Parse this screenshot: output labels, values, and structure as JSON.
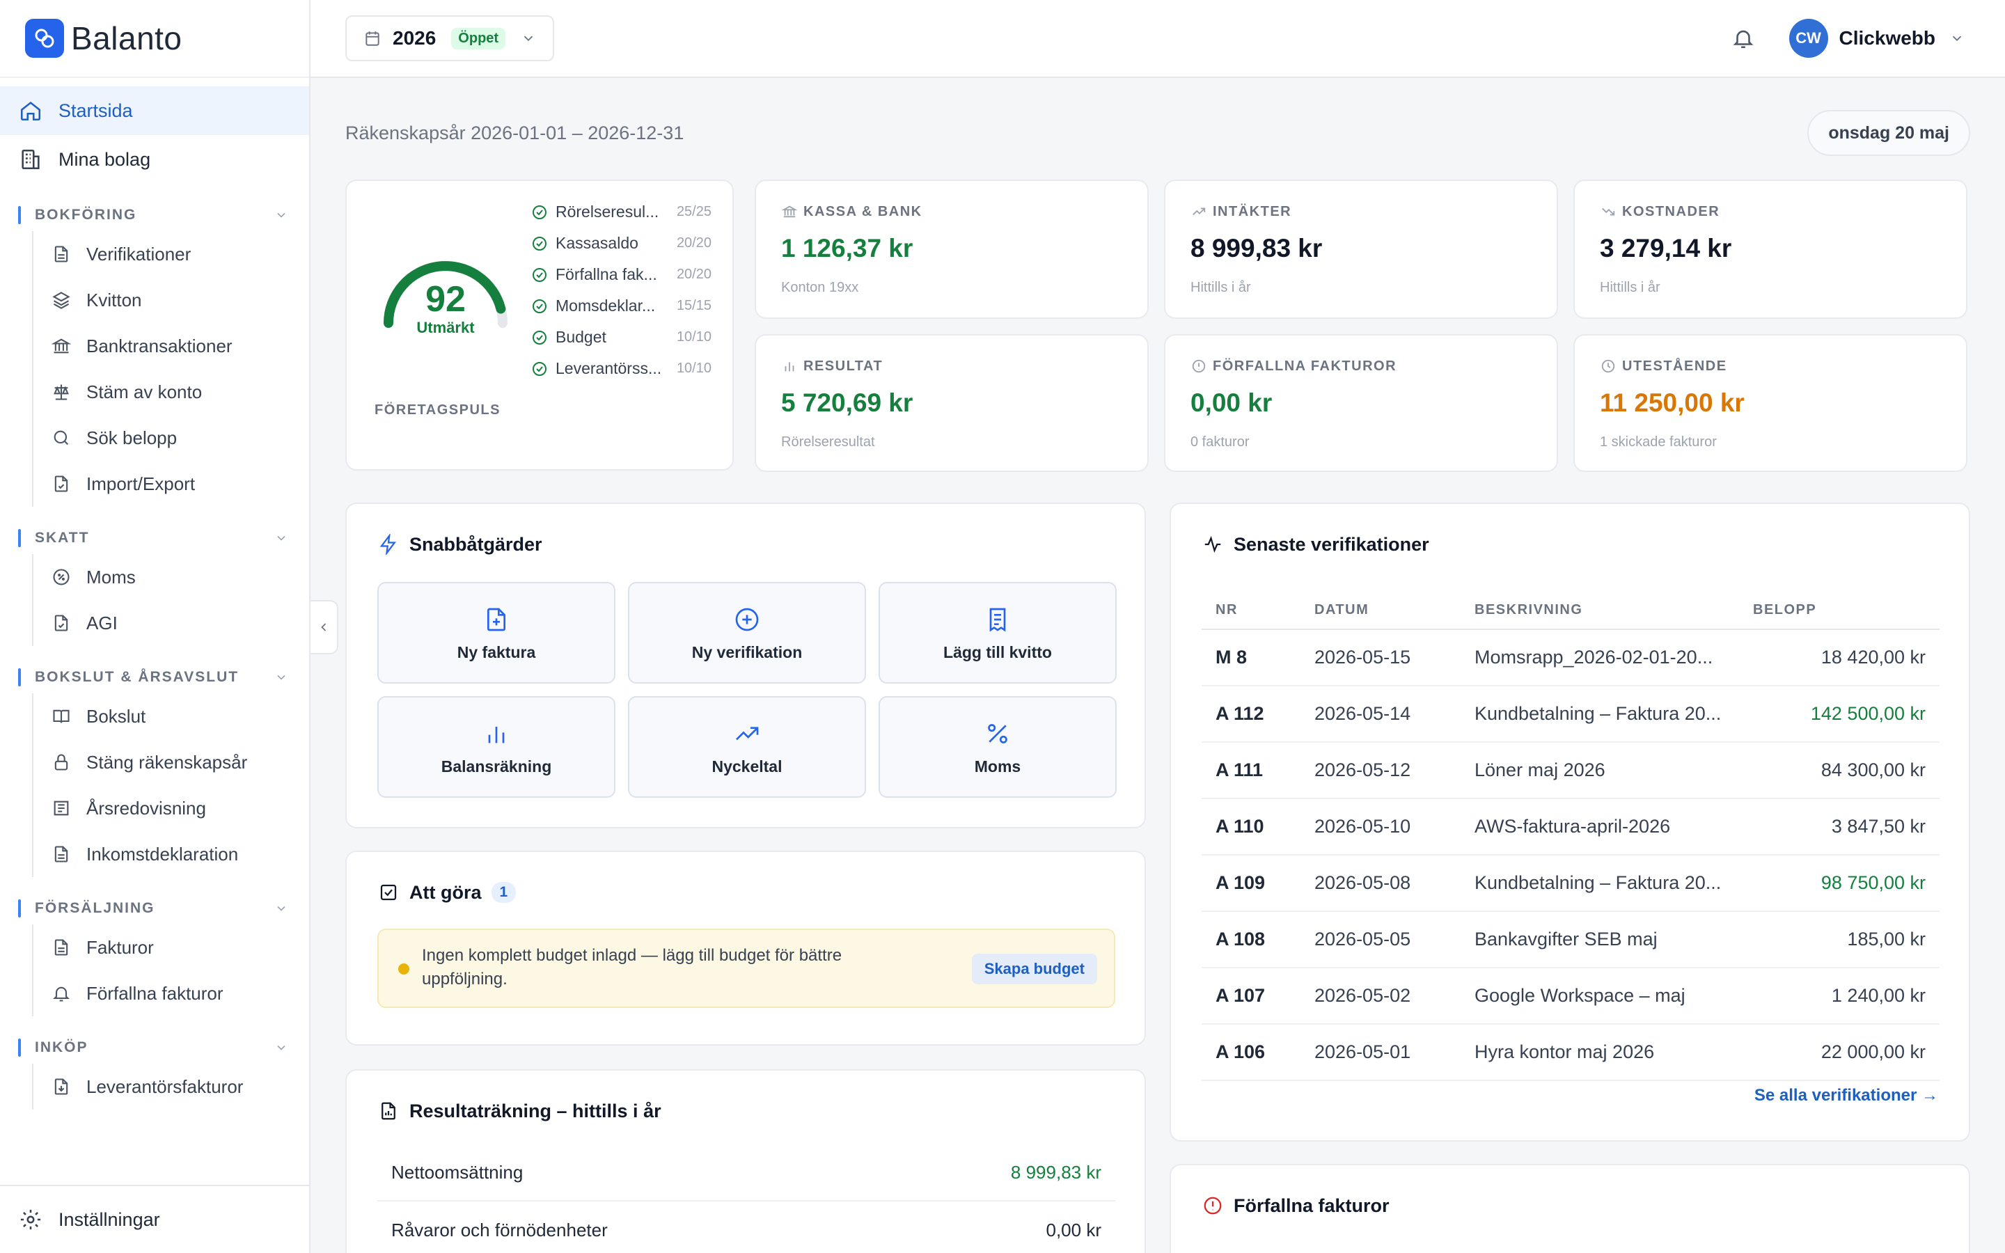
{
  "brand": {
    "name": "Balanto",
    "accent": "#2563eb"
  },
  "sidebar": {
    "top_items": [
      {
        "label": "Startsida",
        "icon": "home-icon",
        "active": true
      },
      {
        "label": "Mina bolag",
        "icon": "building-icon",
        "active": false
      }
    ],
    "sections": [
      {
        "title": "BOKFÖRING",
        "items": [
          {
            "label": "Verifikationer",
            "icon": "document-icon"
          },
          {
            "label": "Kvitton",
            "icon": "layers-icon"
          },
          {
            "label": "Banktransaktioner",
            "icon": "bank-icon"
          },
          {
            "label": "Stäm av konto",
            "icon": "scale-icon"
          },
          {
            "label": "Sök belopp",
            "icon": "search-icon"
          },
          {
            "label": "Import/Export",
            "icon": "file-transfer-icon"
          }
        ]
      },
      {
        "title": "SKATT",
        "items": [
          {
            "label": "Moms",
            "icon": "percent-circle-icon"
          },
          {
            "label": "AGI",
            "icon": "file-check-icon"
          }
        ]
      },
      {
        "title": "BOKSLUT & ÅRSAVSLUT",
        "items": [
          {
            "label": "Bokslut",
            "icon": "book-icon"
          },
          {
            "label": "Stäng räkenskapsår",
            "icon": "lock-icon"
          },
          {
            "label": "Årsredovisning",
            "icon": "report-icon"
          },
          {
            "label": "Inkomstdeklaration",
            "icon": "document-icon"
          }
        ]
      },
      {
        "title": "FÖRSÄLJNING",
        "items": [
          {
            "label": "Fakturor",
            "icon": "document-icon"
          },
          {
            "label": "Förfallna fakturor",
            "icon": "bell-icon"
          }
        ]
      },
      {
        "title": "INKÖP",
        "items": [
          {
            "label": "Leverantörsfakturor",
            "icon": "file-import-icon"
          }
        ]
      }
    ],
    "settings_label": "Inställningar"
  },
  "topbar": {
    "year": "2026",
    "year_status": "Öppet",
    "user_initials": "CW",
    "user_name": "Clickwebb"
  },
  "header": {
    "fiscal_year": "Räkenskapsår 2026-01-01 – 2026-12-31",
    "date": "onsdag 20 maj"
  },
  "pulse": {
    "score": "92",
    "rating": "Utmärkt",
    "score_fraction": 0.92,
    "label": "FÖRETAGSPULS",
    "checks": [
      {
        "name": "Rörelseresul...",
        "score": "25/25"
      },
      {
        "name": "Kassasaldo",
        "score": "20/20"
      },
      {
        "name": "Förfallna fak...",
        "score": "20/20"
      },
      {
        "name": "Momsdeklar...",
        "score": "15/15"
      },
      {
        "name": "Budget",
        "score": "10/10"
      },
      {
        "name": "Leverantörss...",
        "score": "10/10"
      }
    ]
  },
  "kpis": {
    "kassa": {
      "label": "KASSA & BANK",
      "value": "1 126,37 kr",
      "sub": "Konton 19xx"
    },
    "intakter": {
      "label": "INTÄKTER",
      "value": "8 999,83 kr",
      "sub": "Hittills i år"
    },
    "kostnader": {
      "label": "KOSTNADER",
      "value": "3 279,14 kr",
      "sub": "Hittills i år"
    },
    "resultat": {
      "label": "RESULTAT",
      "value": "5 720,69 kr",
      "sub": "Rörelseresultat"
    },
    "forfallna": {
      "label": "FÖRFALLNA FAKTUROR",
      "value": "0,00 kr",
      "sub": "0 fakturor"
    },
    "utestaende": {
      "label": "UTESTÅENDE",
      "value": "11 250,00 kr",
      "sub": "1 skickade fakturor"
    }
  },
  "quick_actions": {
    "title": "Snabbåtgärder",
    "buttons": [
      {
        "label": "Ny faktura",
        "icon": "file-plus-icon"
      },
      {
        "label": "Ny verifikation",
        "icon": "plus-circle-icon"
      },
      {
        "label": "Lägg till kvitto",
        "icon": "receipt-icon"
      },
      {
        "label": "Balansräkning",
        "icon": "bar-chart-icon"
      },
      {
        "label": "Nyckeltal",
        "icon": "trending-up-icon"
      },
      {
        "label": "Moms",
        "icon": "percent-icon"
      }
    ]
  },
  "todo": {
    "title": "Att göra",
    "count": "1",
    "item_text": "Ingen komplett budget inlagd — lägg till budget för bättre uppföljning.",
    "item_action": "Skapa budget"
  },
  "income_statement": {
    "title": "Resultaträkning – hittills i år",
    "rows": [
      {
        "label": "Nettoomsättning",
        "value": "8 999,83 kr"
      },
      {
        "label": "Råvaror och förnödenheter",
        "value": "0,00 kr"
      }
    ]
  },
  "verifications": {
    "title": "Senaste verifikationer",
    "columns": [
      "NR",
      "DATUM",
      "BESKRIVNING",
      "BELOPP"
    ],
    "rows": [
      {
        "nr": "M 8",
        "date": "2026-05-15",
        "desc": "Momsrapp_2026-02-01-20...",
        "amount": "18 420,00 kr",
        "positive": false
      },
      {
        "nr": "A 112",
        "date": "2026-05-14",
        "desc": "Kundbetalning – Faktura 20...",
        "amount": "142 500,00 kr",
        "positive": true
      },
      {
        "nr": "A 111",
        "date": "2026-05-12",
        "desc": "Löner maj 2026",
        "amount": "84 300,00 kr",
        "positive": false
      },
      {
        "nr": "A 110",
        "date": "2026-05-10",
        "desc": "AWS-faktura-april-2026",
        "amount": "3 847,50 kr",
        "positive": false
      },
      {
        "nr": "A 109",
        "date": "2026-05-08",
        "desc": "Kundbetalning – Faktura 20...",
        "amount": "98 750,00 kr",
        "positive": true
      },
      {
        "nr": "A 108",
        "date": "2026-05-05",
        "desc": "Bankavgifter SEB maj",
        "amount": "185,00 kr",
        "positive": false
      },
      {
        "nr": "A 107",
        "date": "2026-05-02",
        "desc": "Google Workspace – maj",
        "amount": "1 240,00 kr",
        "positive": false
      },
      {
        "nr": "A 106",
        "date": "2026-05-01",
        "desc": "Hyra kontor maj 2026",
        "amount": "22 000,00 kr",
        "positive": false
      }
    ],
    "see_all": "Se alla verifikationer →"
  },
  "overdue": {
    "title": "Förfallna fakturor"
  }
}
